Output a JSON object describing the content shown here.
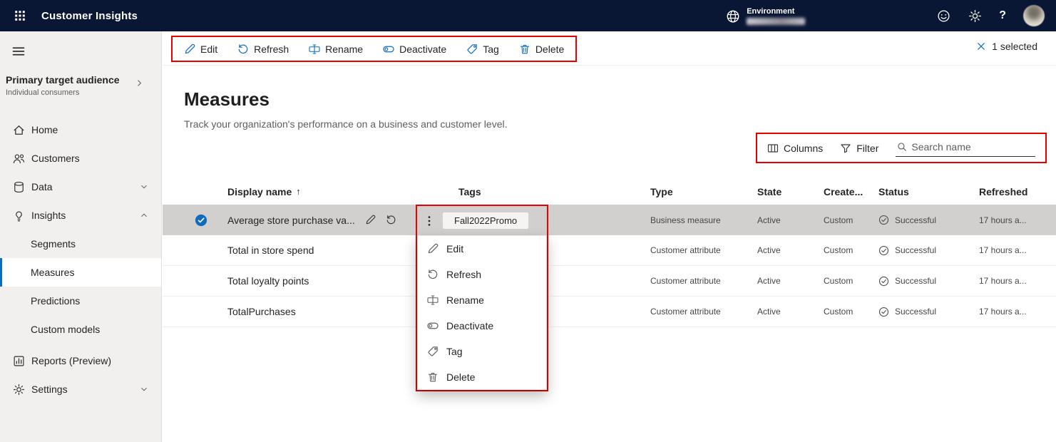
{
  "colors": {
    "accent": "#0c6bc4",
    "topbar_bg": "#0a1734",
    "highlight_red": "#e80000",
    "selected_row_bg": "#d2d0ce"
  },
  "topbar": {
    "app_title": "Customer Insights",
    "environment_label": "Environment",
    "help_glyph": "?"
  },
  "sidebar": {
    "audience": {
      "title": "Primary target audience",
      "subtitle": "Individual consumers"
    },
    "items": {
      "home": "Home",
      "customers": "Customers",
      "data": "Data",
      "insights": "Insights",
      "segments": "Segments",
      "measures": "Measures",
      "predictions": "Predictions",
      "custom_models": "Custom models",
      "reports": "Reports (Preview)",
      "settings": "Settings"
    }
  },
  "command_bar": {
    "actions": [
      "Edit",
      "Refresh",
      "Rename",
      "Deactivate",
      "Tag",
      "Delete"
    ],
    "selection_text": "1 selected"
  },
  "page": {
    "title": "Measures",
    "subtitle": "Track your organization's performance on a business and customer level."
  },
  "list_controls": {
    "columns": "Columns",
    "filter": "Filter",
    "search_placeholder": "Search name"
  },
  "table": {
    "sort_indicator": "↑",
    "headers": {
      "display_name": "Display name",
      "tags": "Tags",
      "type": "Type",
      "state": "State",
      "created": "Create...",
      "status": "Status",
      "refreshed": "Refreshed"
    },
    "rows": [
      {
        "name": "Average store purchase va...",
        "tag": "Fall2022Promo",
        "type": "Business measure",
        "state": "Active",
        "created": "Custom",
        "status": "Successful",
        "refreshed": "17 hours a..."
      },
      {
        "name": "Total in store spend",
        "type": "Customer attribute",
        "state": "Active",
        "created": "Custom",
        "status": "Successful",
        "refreshed": "17 hours a..."
      },
      {
        "name": "Total loyalty points",
        "type": "Customer attribute",
        "state": "Active",
        "created": "Custom",
        "status": "Successful",
        "refreshed": "17 hours a..."
      },
      {
        "name": "TotalPurchases",
        "type": "Customer attribute",
        "state": "Active",
        "created": "Custom",
        "status": "Successful",
        "refreshed": "17 hours a..."
      }
    ]
  },
  "context_menu": {
    "items": [
      "Edit",
      "Refresh",
      "Rename",
      "Deactivate",
      "Tag",
      "Delete"
    ]
  }
}
